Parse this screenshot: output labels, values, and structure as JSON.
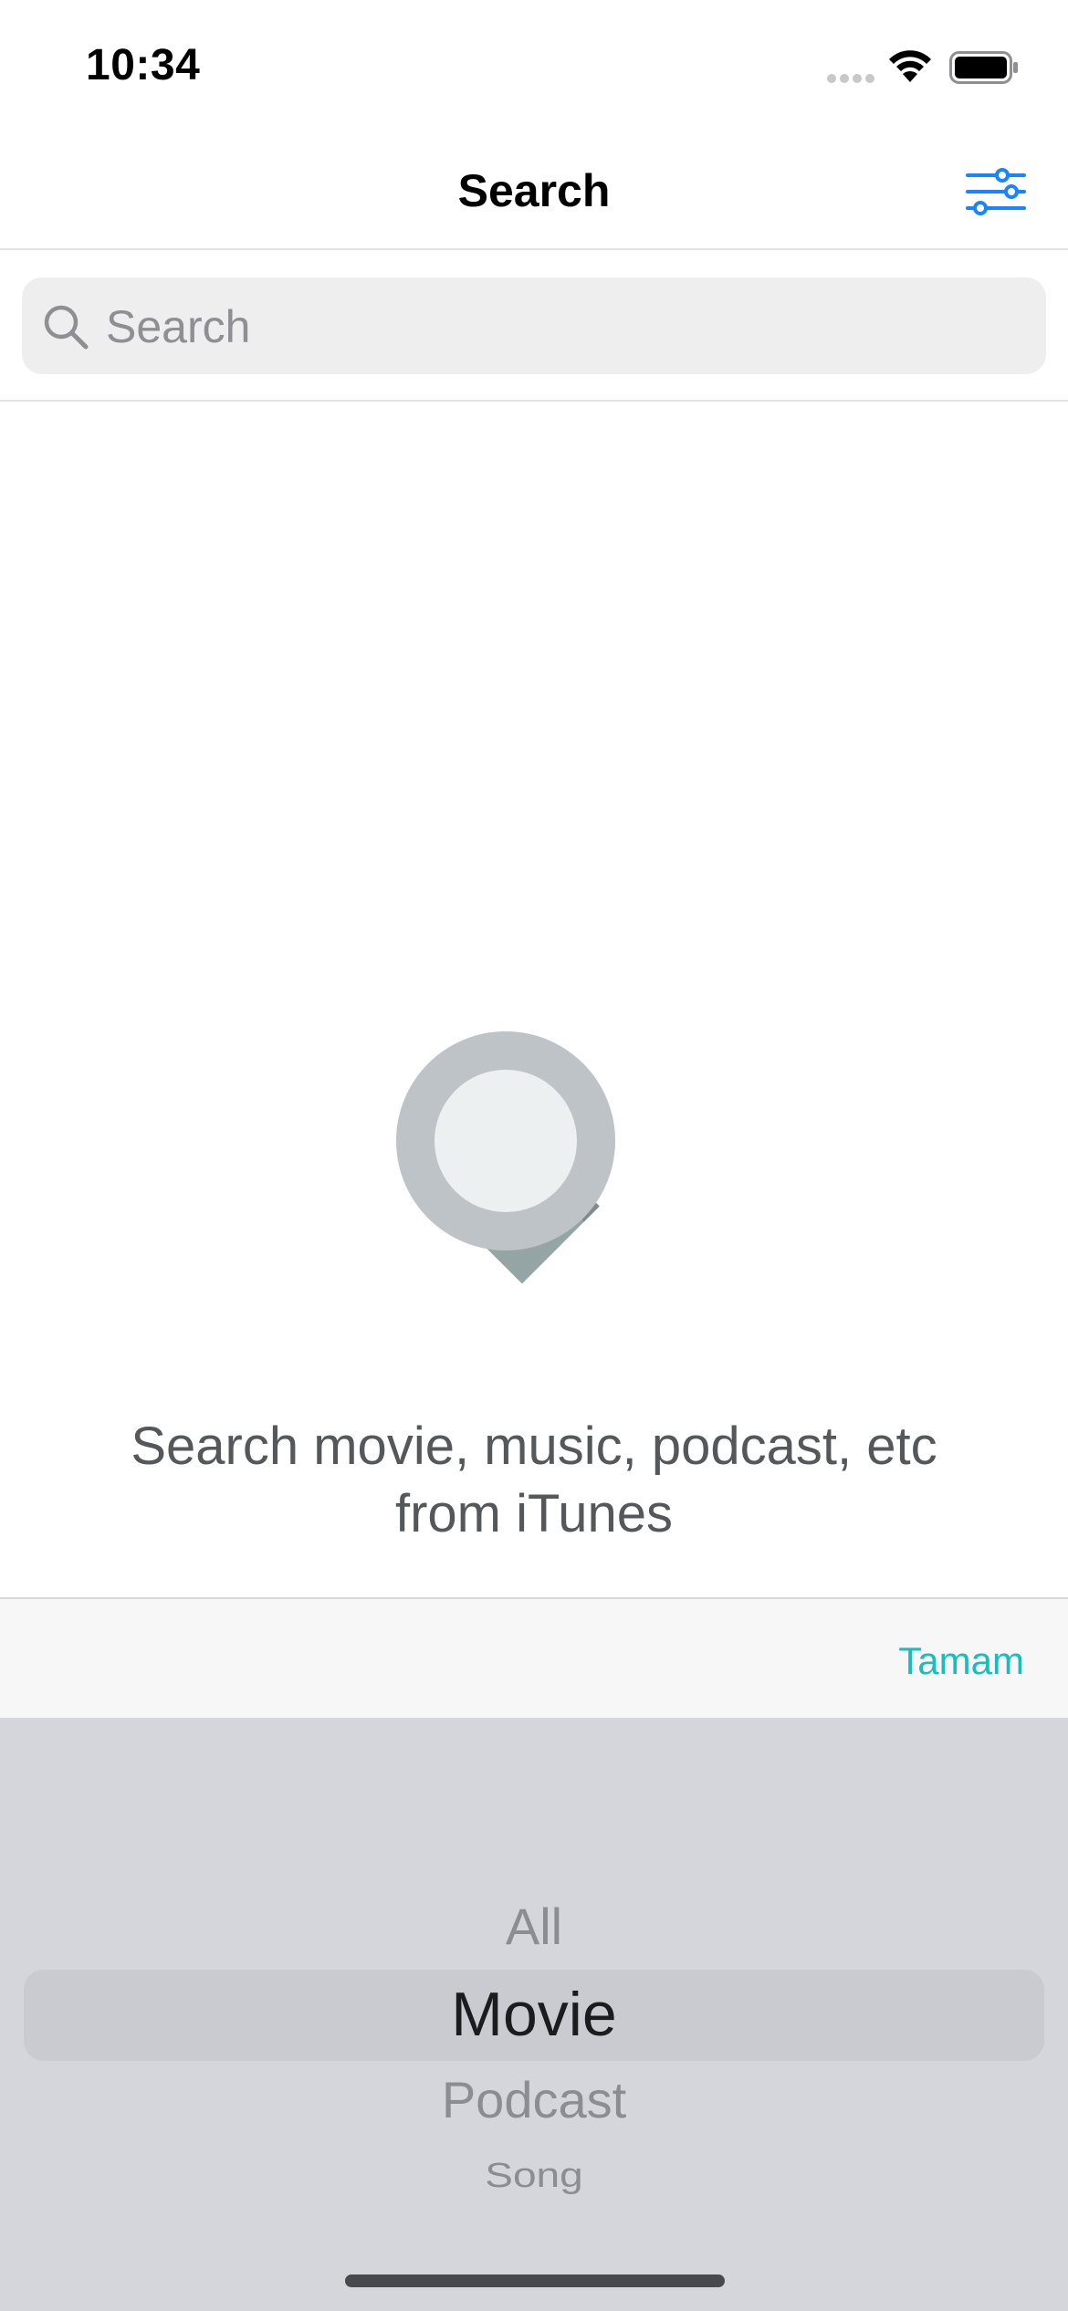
{
  "status_bar": {
    "time": "10:34"
  },
  "nav": {
    "title": "Search",
    "filter_icon": "sliders-icon",
    "accent": "#1a84ff"
  },
  "search": {
    "placeholder": "Search",
    "value": ""
  },
  "empty_state": {
    "icon": "magnifier-illustration",
    "message": "Search movie, music, podcast, etc from iTunes"
  },
  "picker_toolbar": {
    "done_label": "Tamam",
    "done_color": "#1cbcbc"
  },
  "picker": {
    "options": [
      "All",
      "Movie",
      "Podcast",
      "Song"
    ],
    "selected": "Movie"
  }
}
